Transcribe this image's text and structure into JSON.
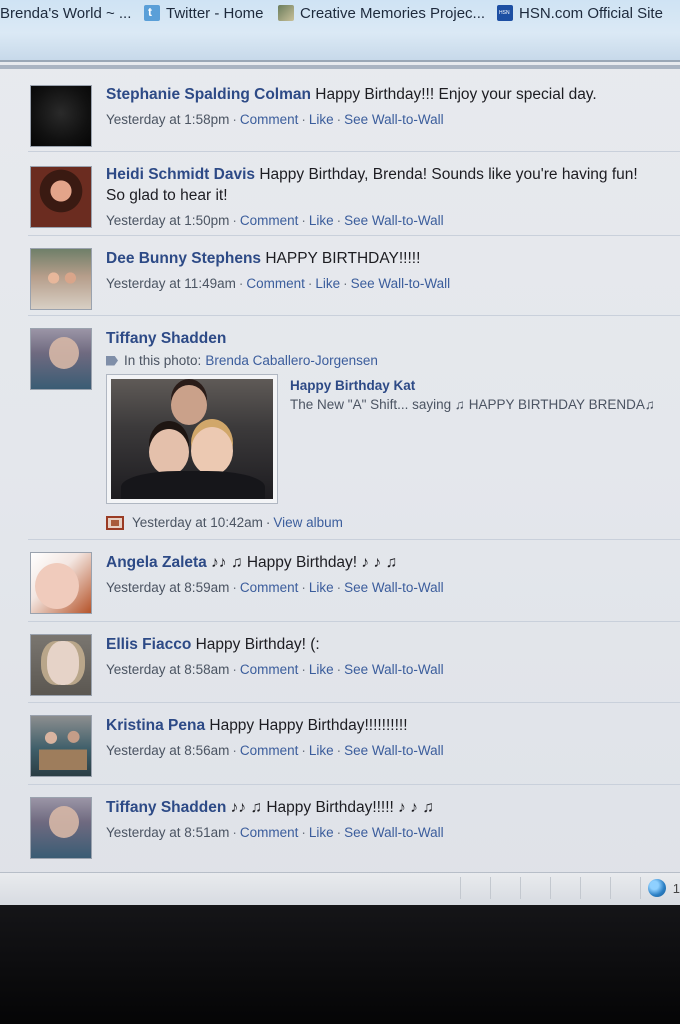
{
  "bookmarks": [
    {
      "label": "Brenda's World ~ ...",
      "icon": "none"
    },
    {
      "label": "Twitter - Home",
      "icon": "twitter-icon"
    },
    {
      "label": "Creative Memories Projec...",
      "icon": "creative-memories-icon"
    },
    {
      "label": "HSN.com Official Site",
      "icon": "hsn-icon"
    }
  ],
  "posts": [
    {
      "name": "Stephanie Spalding Colman",
      "message": "Happy Birthday!!! Enjoy your special day.",
      "time": "Yesterday at 1:58pm",
      "actions": [
        "Comment",
        "Like",
        "See Wall-to-Wall"
      ]
    },
    {
      "name": "Heidi Schmidt Davis",
      "message": "Happy Birthday, Brenda! Sounds like you're having fun! So glad to hear it!",
      "time": "Yesterday at 1:50pm",
      "actions": [
        "Comment",
        "Like",
        "See Wall-to-Wall"
      ]
    },
    {
      "name": "Dee Bunny Stephens",
      "message": "HAPPY BIRTHDAY!!!!!",
      "time": "Yesterday at 11:49am",
      "actions": [
        "Comment",
        "Like",
        "See Wall-to-Wall"
      ]
    },
    {
      "name": "Tiffany Shadden",
      "tag_prefix": "In this photo:",
      "tag_person": "Brenda Caballero-Jorgensen",
      "album_title": "Happy Birthday Kat",
      "album_desc": "The New \"A\" Shift... saying ♫ HAPPY BIRTHDAY BRENDA♫",
      "time": "Yesterday at 10:42am",
      "album_link": "View album"
    },
    {
      "name": "Angela Zaleta",
      "message": "♪♪ ♫ Happy Birthday! ♪ ♪ ♫",
      "time": "Yesterday at 8:59am",
      "actions": [
        "Comment",
        "Like",
        "See Wall-to-Wall"
      ]
    },
    {
      "name": "Ellis Fiacco",
      "message": "Happy Birthday! (:",
      "time": "Yesterday at 8:58am",
      "actions": [
        "Comment",
        "Like",
        "See Wall-to-Wall"
      ]
    },
    {
      "name": "Kristina Pena",
      "message": "Happy Happy Birthday!!!!!!!!!!",
      "time": "Yesterday at 8:56am",
      "actions": [
        "Comment",
        "Like",
        "See Wall-to-Wall"
      ]
    },
    {
      "name": "Tiffany Shadden",
      "message": "♪♪ ♫ Happy Birthday!!!!! ♪ ♪ ♫",
      "time": "Yesterday at 8:51am",
      "actions": [
        "Comment",
        "Like",
        "See Wall-to-Wall"
      ]
    }
  ],
  "statusbar": {
    "zoom_text": "1"
  }
}
